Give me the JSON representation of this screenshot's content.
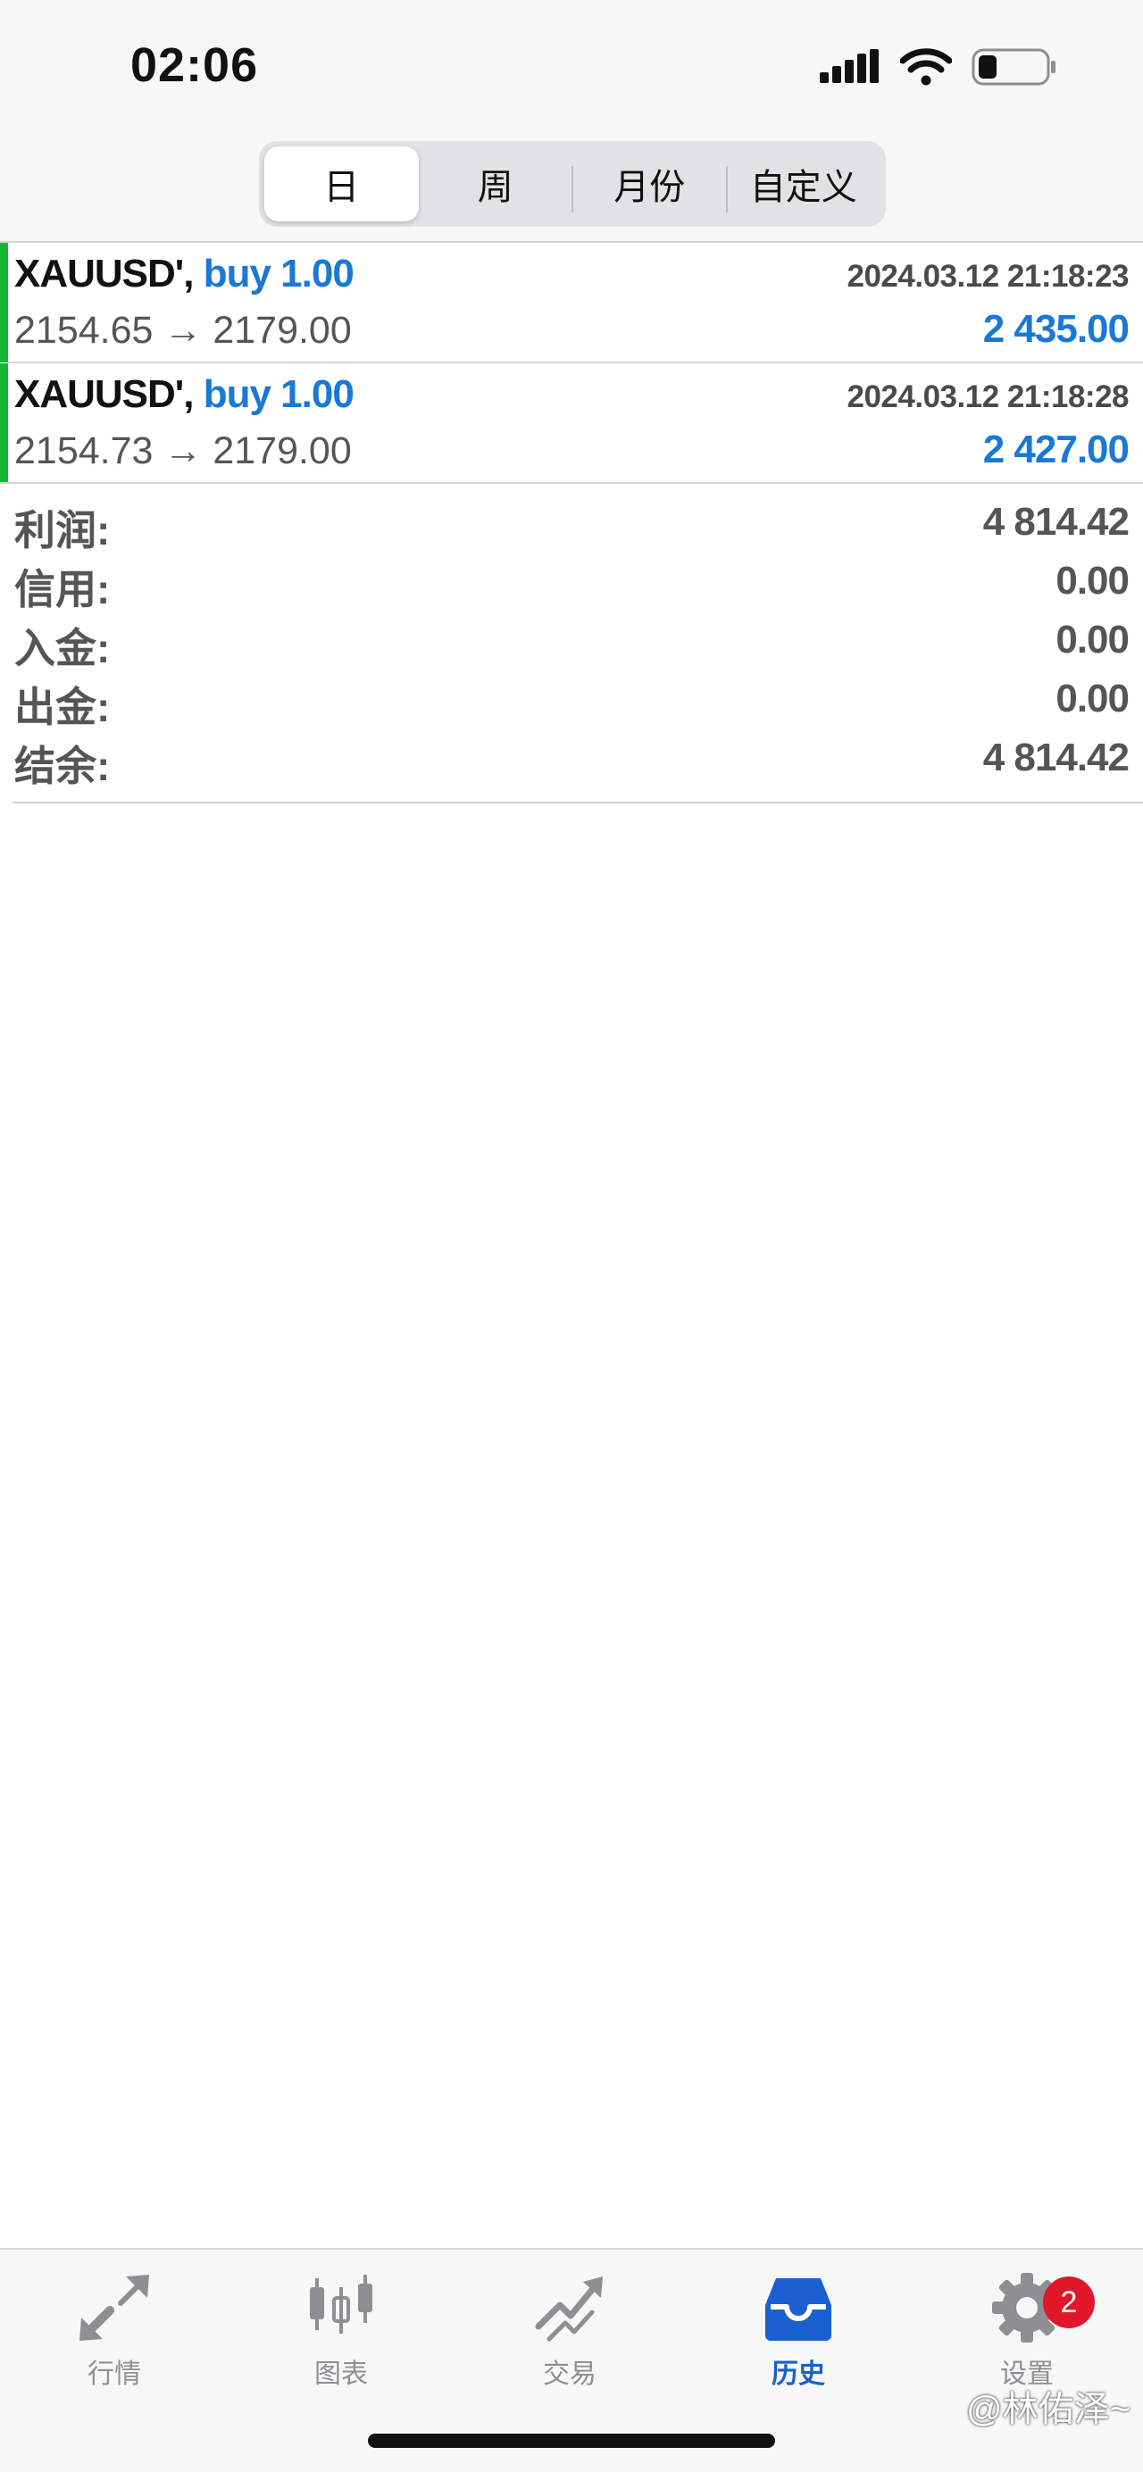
{
  "status_bar": {
    "time": "02:06"
  },
  "segments": [
    {
      "label": "日",
      "active": true
    },
    {
      "label": "周",
      "active": false
    },
    {
      "label": "月份",
      "active": false
    },
    {
      "label": "自定义",
      "active": false
    }
  ],
  "trades": [
    {
      "symbol": "XAUUSD',",
      "action": "buy 1.00",
      "datetime": "2024.03.12 21:18:23",
      "prices": "2154.65 → 2179.00",
      "profit": "2 435.00"
    },
    {
      "symbol": "XAUUSD',",
      "action": "buy 1.00",
      "datetime": "2024.03.12 21:18:28",
      "prices": "2154.73 → 2179.00",
      "profit": "2 427.00"
    }
  ],
  "summary": [
    {
      "label": "利润:",
      "value": "4 814.42"
    },
    {
      "label": "信用:",
      "value": "0.00"
    },
    {
      "label": "入金:",
      "value": "0.00"
    },
    {
      "label": "出金:",
      "value": "0.00"
    },
    {
      "label": "结余:",
      "value": "4 814.42"
    }
  ],
  "tabs": [
    {
      "label": "行情",
      "icon": "quotes-arrows-icon"
    },
    {
      "label": "图表",
      "icon": "candlestick-chart-icon"
    },
    {
      "label": "交易",
      "icon": "trade-trend-icon"
    },
    {
      "label": "历史",
      "icon": "history-inbox-icon",
      "active": true
    },
    {
      "label": "设置",
      "icon": "gear-icon",
      "badge": "2"
    }
  ],
  "watermark": "@林佑泽~",
  "colors": {
    "accent_blue": "#1a78d6",
    "active_tab_blue": "#1a5fd0",
    "buy_bar_green": "#18b634",
    "badge_red": "#e0162b",
    "inactive_gray": "#8e8e93"
  }
}
